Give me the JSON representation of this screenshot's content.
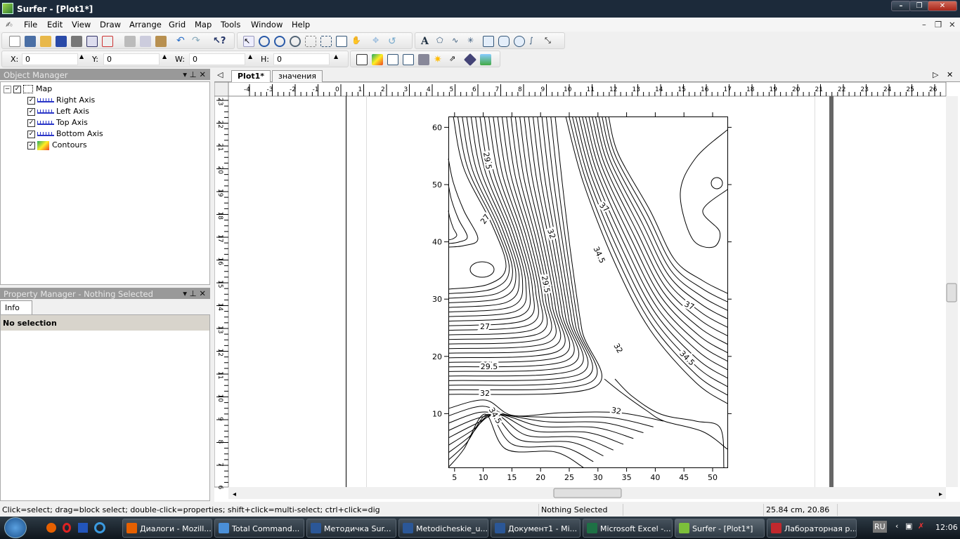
{
  "window": {
    "title": "Surfer - [Plot1*]"
  },
  "menu": [
    "File",
    "Edit",
    "View",
    "Draw",
    "Arrange",
    "Grid",
    "Map",
    "Tools",
    "Window",
    "Help"
  ],
  "toolbar": {
    "x_label": "X:",
    "x_value": "0",
    "y_label": "Y:",
    "y_value": "0",
    "w_label": "W:",
    "w_value": "0",
    "h_label": "H:",
    "h_value": "0"
  },
  "object_manager": {
    "title": "Object Manager",
    "items": [
      {
        "label": "Map",
        "icon": "map-frame-icon",
        "checked": true
      },
      {
        "label": "Right Axis",
        "icon": "axis-icon",
        "checked": true
      },
      {
        "label": "Left Axis",
        "icon": "axis-icon",
        "checked": true
      },
      {
        "label": "Top Axis",
        "icon": "axis-icon",
        "checked": true
      },
      {
        "label": "Bottom Axis",
        "icon": "axis-icon",
        "checked": true
      },
      {
        "label": "Contours",
        "icon": "contours-icon",
        "checked": true
      }
    ]
  },
  "property_manager": {
    "title": "Property Manager - Nothing Selected",
    "tab": "Info",
    "selection": "No selection"
  },
  "doc_tabs": [
    {
      "label": "Plot1*",
      "active": true
    },
    {
      "label": "значения",
      "active": false
    }
  ],
  "ruler": {
    "unit": "cm",
    "top_from": -4,
    "top_to": 26,
    "left_from": 23,
    "left_to": 6
  },
  "chart_data": {
    "type": "contour",
    "xticks": [
      5,
      10,
      15,
      20,
      25,
      30,
      35,
      40,
      45,
      50
    ],
    "yticks": [
      10,
      20,
      30,
      40,
      50,
      60
    ],
    "xlim": [
      4,
      52.5
    ],
    "ylim": [
      0.6,
      62
    ],
    "contour_labels": [
      "29.5",
      "27",
      "32",
      "34.5",
      "37",
      "29.5",
      "37",
      "27",
      "32",
      "34.5",
      "29.5",
      "32",
      "32",
      "34.5"
    ]
  },
  "status": {
    "hint": "Click=select; drag=block select; double-click=properties; shift+click=multi-select; ctrl+click=dig",
    "selection": "Nothing Selected",
    "coords": "25.84 cm, 20.86 cm"
  },
  "taskbar": {
    "tasks": [
      {
        "label": "Диалоги - Mozill...",
        "color": "#e66000"
      },
      {
        "label": "Total Command...",
        "color": "#4a8fd8"
      },
      {
        "label": "Методичка Sur...",
        "color": "#2b5797"
      },
      {
        "label": "Metodicheskie_u...",
        "color": "#2b5797"
      },
      {
        "label": "Документ1 - Mi...",
        "color": "#2b5797"
      },
      {
        "label": "Microsoft Excel -...",
        "color": "#1e7145"
      },
      {
        "label": "Surfer - [Plot1*]",
        "color": "#7cbf3a"
      },
      {
        "label": "Лабораторная р...",
        "color": "#c0282d"
      }
    ],
    "lang": "RU",
    "time": "12:06"
  }
}
